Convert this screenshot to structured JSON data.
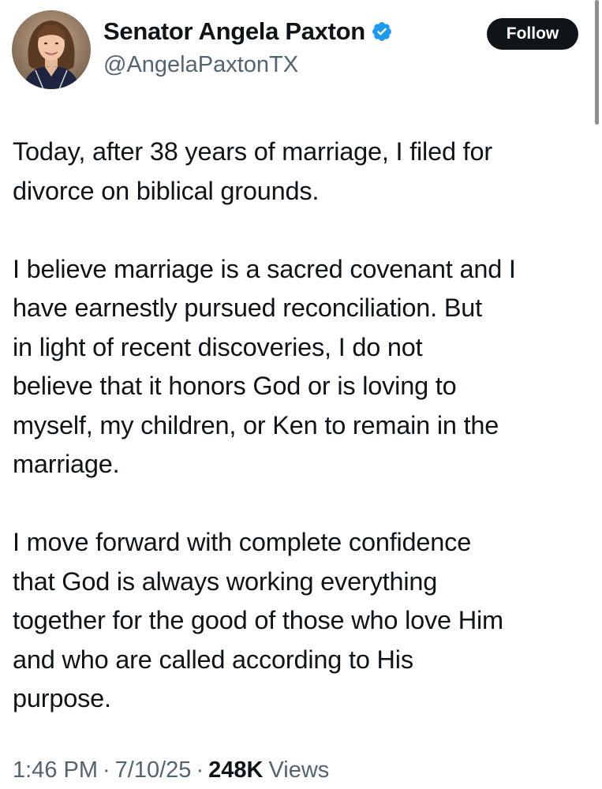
{
  "author": {
    "display_name": "Senator Angela Paxton",
    "handle": "@AngelaPaxtonTX",
    "verified_icon": "verified-badge-icon",
    "verified_color": "#1d9bf0",
    "avatar": "profile-photo"
  },
  "follow_button": {
    "label": "Follow"
  },
  "tweet": {
    "paragraphs": [
      "Today, after 38 years of marriage, I filed for\ndivorce on biblical grounds.",
      "I believe marriage is a sacred covenant and I\nhave earnestly pursued reconciliation. But\nin light of recent discoveries, I do not\nbelieve that it honors God or is loving to\nmyself, my children, or Ken to remain in the\nmarriage.",
      "I move forward with complete confidence\nthat God is always working everything\ntogether for the good of those who love Him\nand who are called according to His\npurpose."
    ]
  },
  "meta": {
    "time": "1:46 PM",
    "separator": "·",
    "date": "7/10/25",
    "views_count": "248K",
    "views_label": "Views"
  },
  "colors": {
    "text": "#0f1419",
    "secondary_text": "#536471",
    "button_bg": "#0f1419",
    "button_text": "#ffffff"
  }
}
